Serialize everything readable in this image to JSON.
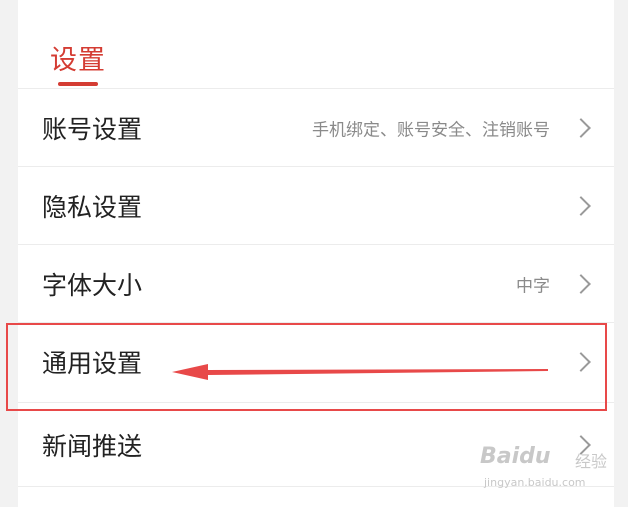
{
  "header": {
    "title": "设置"
  },
  "rows": [
    {
      "label": "账号设置",
      "value": "手机绑定、账号安全、注销账号"
    },
    {
      "label": "隐私设置",
      "value": ""
    },
    {
      "label": "字体大小",
      "value": "中字"
    },
    {
      "label": "通用设置",
      "value": ""
    },
    {
      "label": "新闻推送",
      "value": ""
    }
  ],
  "annotation": {
    "color": "#e84949",
    "target": "通用设置"
  },
  "watermark": {
    "brand": "Baidu",
    "suffix": "经验",
    "url": "jingyan.baidu.com"
  },
  "theme": {
    "accent": "#d43c33"
  }
}
